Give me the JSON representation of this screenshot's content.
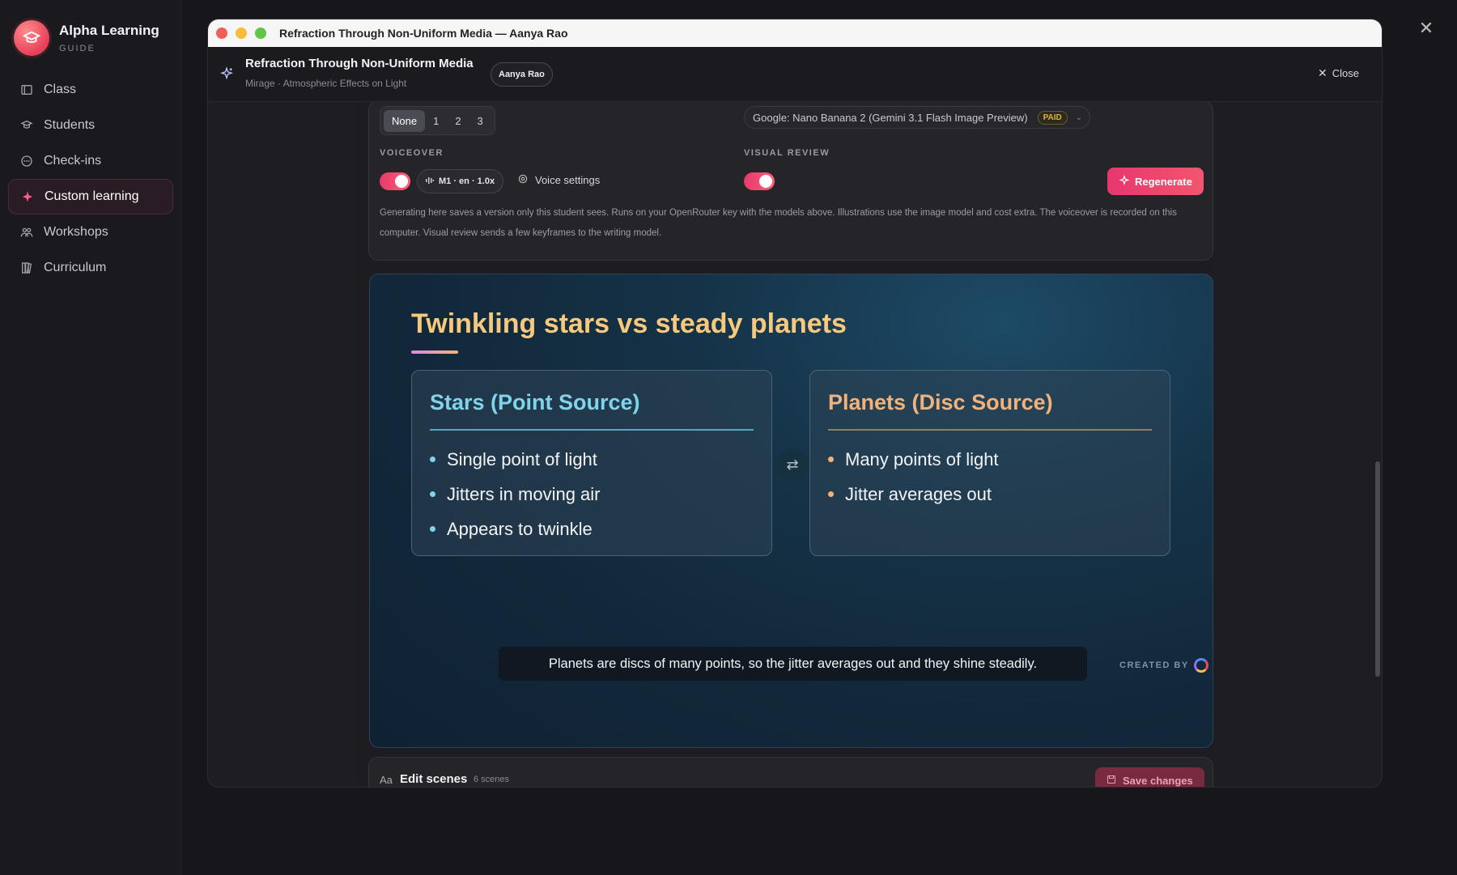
{
  "sidebar": {
    "brand_title": "Alpha Learning",
    "brand_sub": "GUIDE",
    "items": [
      {
        "label": "Class",
        "icon": "class-icon"
      },
      {
        "label": "Students",
        "icon": "students-icon"
      },
      {
        "label": "Check-ins",
        "icon": "chat-icon"
      },
      {
        "label": "Custom learning",
        "icon": "sparkle-icon",
        "active": true
      },
      {
        "label": "Workshops",
        "icon": "people-icon"
      },
      {
        "label": "Curriculum",
        "icon": "books-icon"
      }
    ]
  },
  "window": {
    "titlebar": "Refraction Through Non-Uniform Media — Aanya Rao",
    "title": "Refraction Through Non-Uniform Media",
    "subtitle": "Mirage · Atmospheric Effects on Light",
    "student_chip": "Aanya Rao",
    "close_label": "Close"
  },
  "settings": {
    "segments": [
      "None",
      "1",
      "2",
      "3"
    ],
    "selected_segment": "None",
    "model": "Google: Nano Banana 2 (Gemini 3.1 Flash Image Preview)",
    "model_badge": "PAID",
    "voiceover_label": "VOICEOVER",
    "voice_pill": "M1 · en · 1.0x",
    "voice_settings": "Voice settings",
    "visual_review_label": "VISUAL REVIEW",
    "regenerate": "Regenerate",
    "note": "Generating here saves a version only this student sees. Runs on your OpenRouter key with the models above. Illustrations use the image model and cost extra. The voiceover is recorded on this computer. Visual review sends a few keyframes to the writing model.",
    "voiceover_on": true,
    "visual_review_on": true
  },
  "slide": {
    "title": "Twinkling stars vs steady planets",
    "left": {
      "heading": "Stars (Point Source)",
      "color": "#7fd3ea",
      "items": [
        "Single point of light",
        "Jitters in moving air",
        "Appears to twinkle"
      ]
    },
    "right": {
      "heading": "Planets (Disc Source)",
      "color": "#f3b27a",
      "items": [
        "Many points of light",
        "Jitter averages out"
      ]
    },
    "caption": "Planets are discs of many points, so the jitter averages out and they shine steadily.",
    "created_by": "CREATED BY"
  },
  "edit": {
    "aa": "Aa",
    "title": "Edit scenes",
    "count": "6 scenes",
    "save": "Save changes"
  },
  "colors": {
    "accent": "#e8366f",
    "title": "#f7c97d"
  }
}
